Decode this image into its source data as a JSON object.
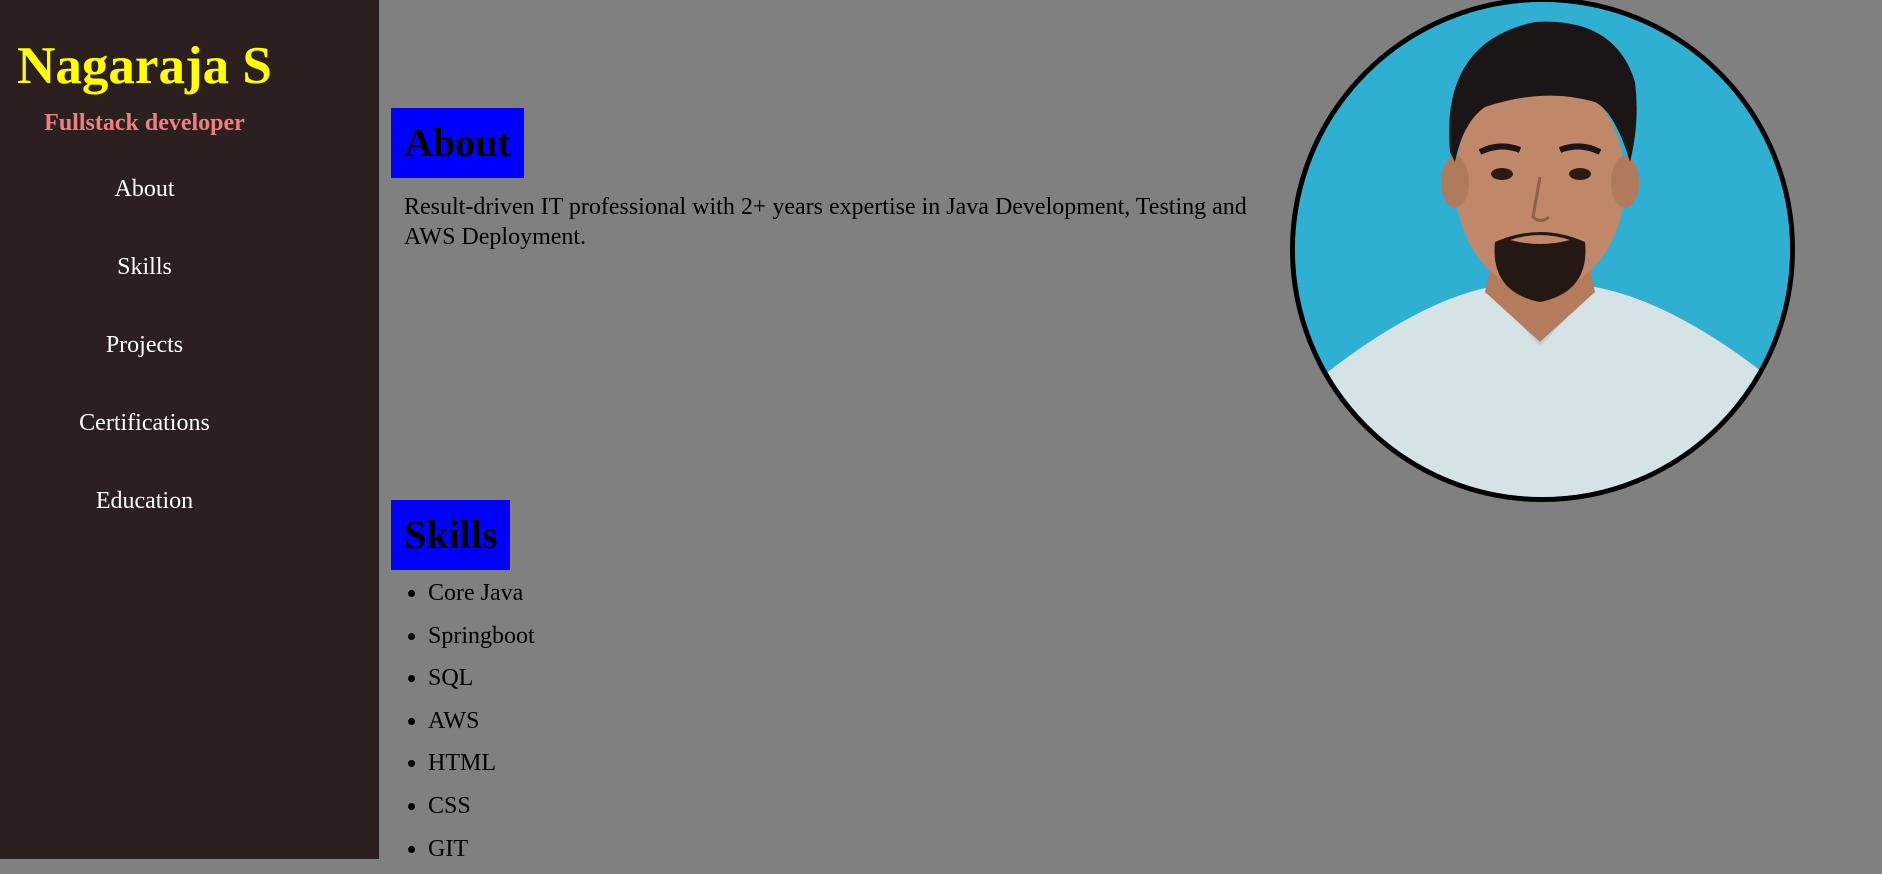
{
  "sidebar": {
    "name": "Nagaraja S",
    "role": "Fullstack developer",
    "nav": [
      {
        "label": "About"
      },
      {
        "label": "Skills"
      },
      {
        "label": "Projects"
      },
      {
        "label": "Certifications"
      },
      {
        "label": "Education"
      }
    ]
  },
  "about": {
    "heading": "About",
    "text": "Result-driven IT professional with 2+ years expertise in Java Development, Testing and AWS Deployment."
  },
  "skills": {
    "heading": "Skills",
    "items": [
      "Core Java",
      "Springboot",
      "SQL",
      "AWS",
      "HTML",
      "CSS",
      "GIT"
    ]
  },
  "colors": {
    "sidebar_bg": "#2b1f1f",
    "page_bg": "#808080",
    "name": "#ffff00",
    "role": "#f08080",
    "heading_bg": "#0000ff",
    "photo_bg": "#2fb0d3"
  }
}
